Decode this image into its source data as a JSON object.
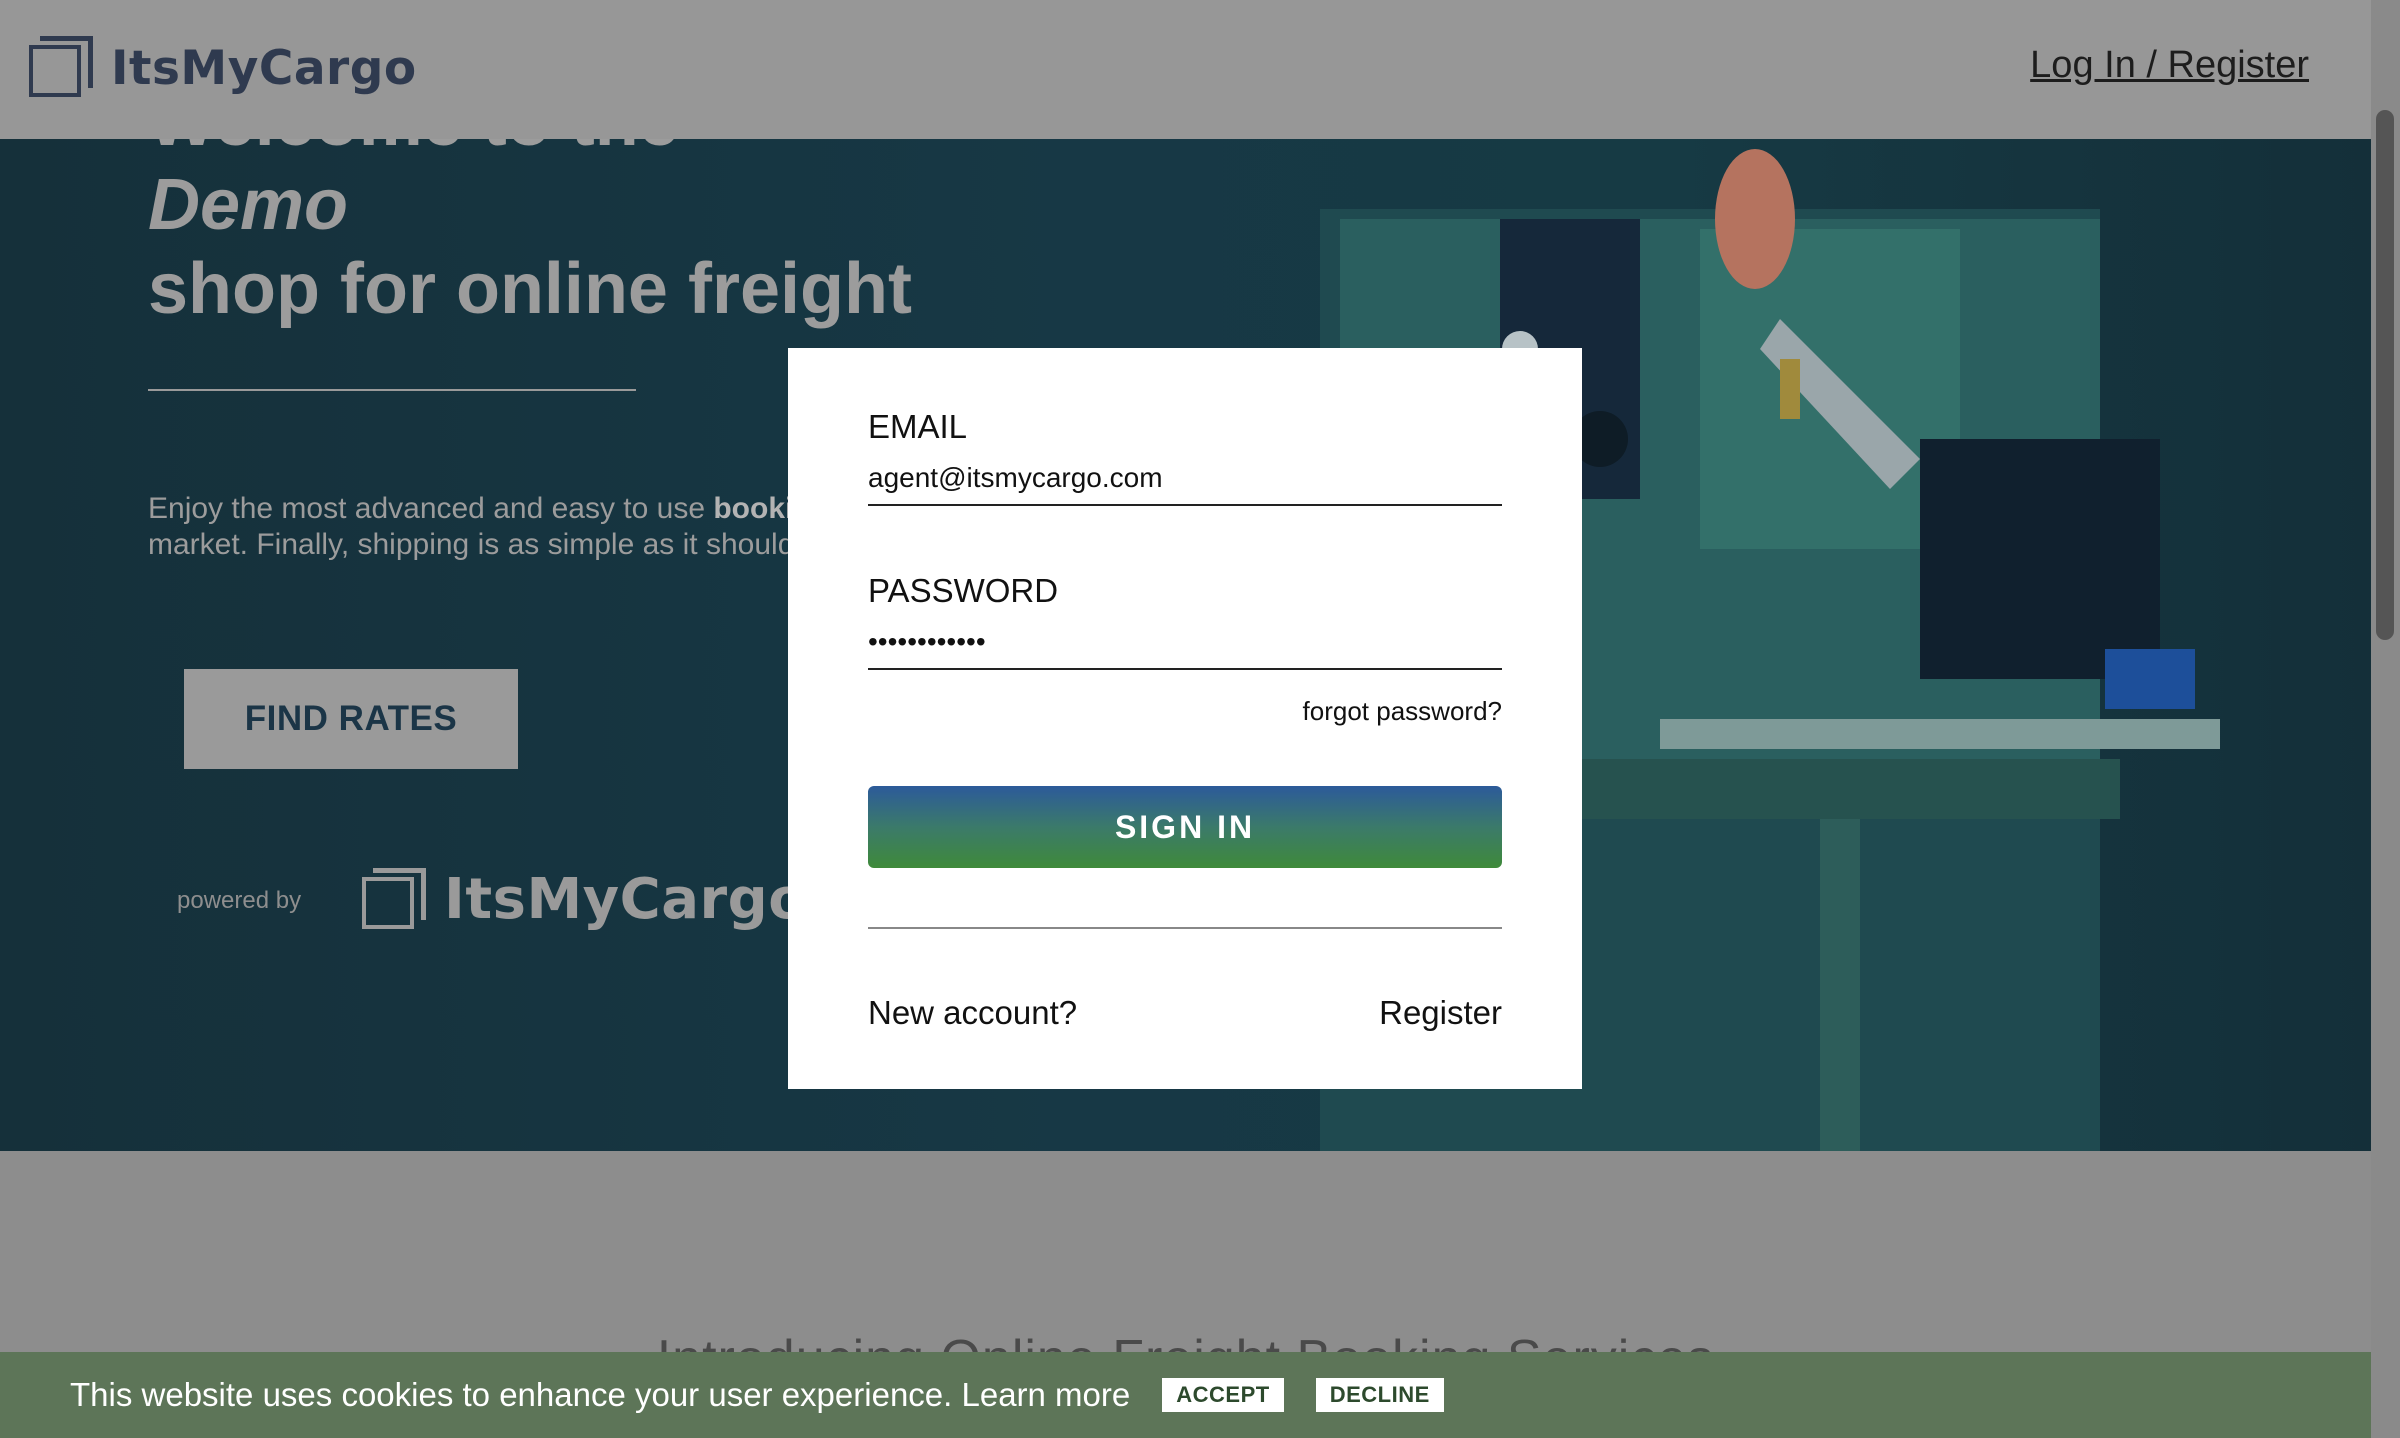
{
  "header": {
    "brand": "ItsMyCargo",
    "login_link": "Log In / Register"
  },
  "hero": {
    "title_line1": "Welcome to the",
    "title_line2": "Demo",
    "title_line3": "shop for online freight",
    "text_plain": "Enjoy the most advanced and easy to use ",
    "text_bold": "bookin",
    "text_line2": "market. Finally, shipping is as simple as it should",
    "find_rates": "FIND RATES",
    "powered_by": "powered by",
    "powered_brand": "ItsMyCargo"
  },
  "login_modal": {
    "email_label": "EMAIL",
    "email_value": "agent@itsmycargo.com",
    "password_label": "PASSWORD",
    "password_value": "••••••••••••",
    "forgot": "forgot password?",
    "signin": "SIGN IN",
    "new_account": "New account?",
    "register": "Register"
  },
  "lower": {
    "intro_title": "Introducing Online Freight Booking Services"
  },
  "cookie": {
    "text": "This website uses cookies to enhance your user experience. Learn more",
    "accept": "ACCEPT",
    "decline": "DECLINE"
  },
  "colors": {
    "overlay": "#979797",
    "brand_navy": "#2f3a4f",
    "cookie_bar": "#5d7558",
    "signin_top": "#2c5a9a",
    "signin_bottom": "#3f8a3a"
  }
}
